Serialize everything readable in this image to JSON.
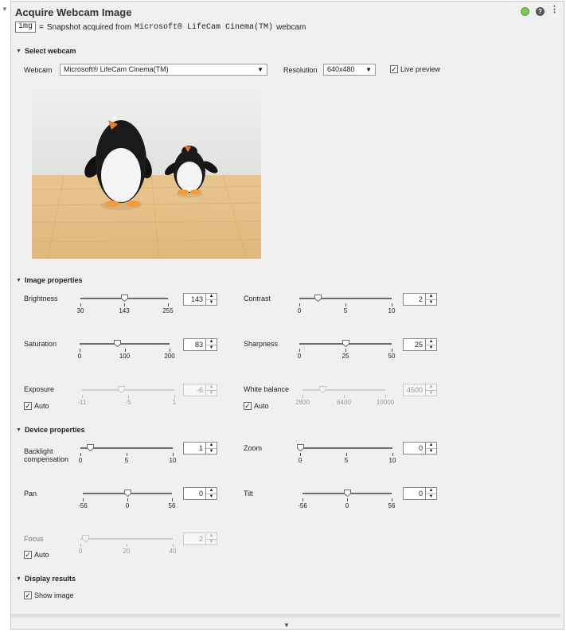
{
  "header": {
    "title": "Acquire Webcam Image",
    "var_name": "img",
    "equals": "=",
    "desc_prefix": "Snapshot acquired from",
    "device": "Microsoft® LifeCam Cinema(TM)",
    "desc_suffix": "webcam"
  },
  "status": {
    "color": "#7cc656",
    "help": "?"
  },
  "sections": {
    "select": "Select webcam",
    "image": "Image properties",
    "device": "Device properties",
    "display": "Display results"
  },
  "webcam": {
    "label": "Webcam",
    "value": "Microsoft® LifeCam Cinema(TM)",
    "res_label": "Resolution",
    "res_value": "640x480",
    "live_label": "Live preview",
    "live_checked": true
  },
  "image_props": {
    "brightness": {
      "label": "Brightness",
      "value": "143",
      "min": "30",
      "mid": "143",
      "max": "255",
      "level": 0.5
    },
    "contrast": {
      "label": "Contrast",
      "value": "2",
      "min": "0",
      "mid": "5",
      "max": "10",
      "level": 0.2
    },
    "saturation": {
      "label": "Saturation",
      "value": "83",
      "min": "0",
      "mid": "100",
      "max": "200",
      "level": 0.415
    },
    "sharpness": {
      "label": "Sharpness",
      "value": "25",
      "min": "0",
      "mid": "25",
      "max": "50",
      "level": 0.5
    },
    "exposure": {
      "label": "Exposure",
      "value": "-6",
      "min": "-11",
      "mid": "-5",
      "max": "1",
      "level": 0.42,
      "auto_label": "Auto"
    },
    "white_balance": {
      "label": "White balance",
      "value": "4500",
      "min": "2800",
      "mid": "6400",
      "max": "10000",
      "level": 0.24,
      "auto_label": "Auto"
    }
  },
  "device_props": {
    "backlight": {
      "label_line1": "Backlight",
      "label_line2": "compensation",
      "value": "1",
      "min": "0",
      "mid": "5",
      "max": "10",
      "level": 0.1
    },
    "zoom": {
      "label": "Zoom",
      "value": "0",
      "min": "0",
      "mid": "5",
      "max": "10",
      "level": 0.0
    },
    "pan": {
      "label": "Pan",
      "value": "0",
      "min": "-56",
      "mid": "0",
      "max": "56",
      "level": 0.5
    },
    "tilt": {
      "label": "Tilt",
      "value": "0",
      "min": "-56",
      "mid": "0",
      "max": "56",
      "level": 0.5
    },
    "focus": {
      "label": "Focus",
      "value": "2",
      "min": "0",
      "mid": "20",
      "max": "40",
      "level": 0.05,
      "auto_label": "Auto"
    }
  },
  "display": {
    "show_image_label": "Show image",
    "show_image_checked": true
  }
}
